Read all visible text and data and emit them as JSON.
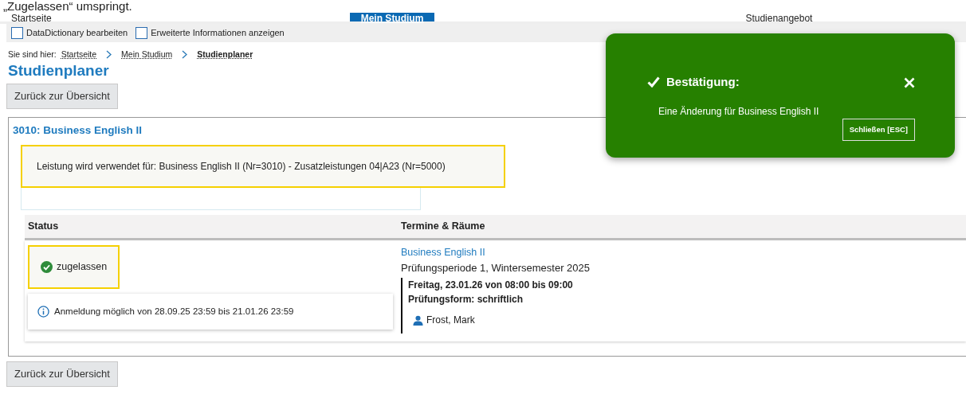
{
  "caption": "„Zugelassen“ umspringt.",
  "nav": [
    {
      "label": "Startseite",
      "selected": false
    },
    {
      "label": "Mein Studium",
      "selected": true
    },
    {
      "label": "Studienangebot",
      "selected": false
    }
  ],
  "options": [
    {
      "label": "DataDictionary bearbeiten",
      "checked": false
    },
    {
      "label": "Erweiterte Informationen anzeigen",
      "checked": false
    }
  ],
  "breadcrumb": {
    "prefix": "Sie sind hier:",
    "items": [
      {
        "label": "Startseite",
        "selected": false
      },
      {
        "label": "Mein Studium",
        "selected": false
      },
      {
        "label": "Studienplaner",
        "selected": true
      }
    ]
  },
  "page_title": "Studienplaner",
  "back_button": "Zurück zur Übersicht",
  "module": {
    "title": "3010: Business English II",
    "usage_note": "Leistung wird verwendet für: Business English II (Nr=3010) - Zusatzleistungen 04|A23 (Nr=5000)",
    "table": {
      "columns": [
        "Status",
        "Termine & Räume"
      ],
      "rows": [
        {
          "status": {
            "label": "zugelassen",
            "kind": "approved"
          },
          "registration_info": "Anmeldung möglich von 28.09.25 23:59 bis 21.01.26 23:59",
          "appointment": {
            "link": "Business English II",
            "period": "Prüfungsperiode 1, Wintersemester 2025",
            "date": "Freitag, 23.01.26 von 08:00 bis 09:00",
            "exam_form": "Prüfungsform: schriftlich",
            "examiner": "Frost, Mark"
          }
        }
      ]
    }
  },
  "back_button_bottom": "Zurück zur Übersicht",
  "toast": {
    "title": "Bestätigung:",
    "message": "Eine Änderung für Business English II",
    "button": "Schließen [ESC]"
  }
}
